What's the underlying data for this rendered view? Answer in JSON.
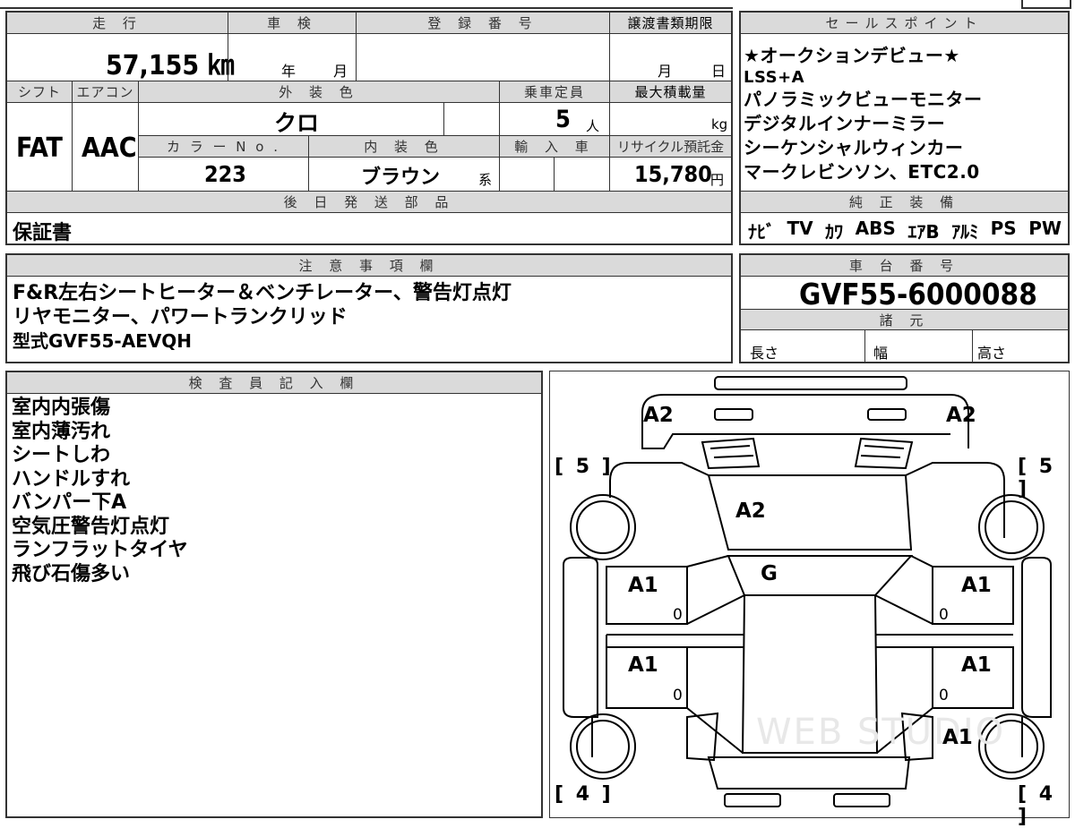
{
  "info": {
    "mileage_header": "走 行",
    "mileage": "57,155 ㎞",
    "inspection_header": "車 検",
    "inspection_year": "年",
    "inspection_month": "月",
    "registration_header": "登 録 番 号",
    "transfer_header": "譲渡書類期限",
    "transfer_month": "月",
    "transfer_day": "日",
    "shift_header": "シフト",
    "shift": "FAT",
    "ac_header": "エアコン",
    "ac": "AAC",
    "exterior_header": "外 装 色",
    "exterior_color": "クロ",
    "capacity_header": "乗車定員",
    "capacity": "5",
    "capacity_unit": "人",
    "max_load_header": "最大積載量",
    "max_load_unit": "kg",
    "color_no_header": "カ ラ ー N o .",
    "color_no": "223",
    "interior_header": "内 装 色",
    "interior_color": "ブラウン",
    "interior_suffix": "系",
    "import_header": "輸 入 車",
    "recycle_header": "リサイクル預託金",
    "recycle_fee": "15,780",
    "recycle_unit": "円",
    "later_parts_header": "後 日 発 送 部 品",
    "later_parts": "保証書"
  },
  "sales": {
    "header": "セールスポイント",
    "lines": [
      "★オークションデビュー★",
      "LSS+A",
      "パノラミックビューモニター",
      "デジタルインナーミラー",
      "シーケンシャルウィンカー",
      "マークレビンソン、ETC2.0"
    ]
  },
  "equipment": {
    "header": "純 正 装 備",
    "items": [
      "ﾅﾋﾞ",
      "TV",
      "ｶﾜ",
      "ABS",
      "ｴｱB",
      "ｱﾙﾐ",
      "PS",
      "PW"
    ]
  },
  "notes": {
    "header": "注 意 事 項 欄",
    "lines": [
      "F&R左右シートヒーター＆ベンチレーター、警告灯点灯",
      "リヤモニター、パワートランクリッド",
      "型式GVF55-AEVQH"
    ]
  },
  "chassis": {
    "header": "車 台 番 号",
    "number": "GVF55-6000088"
  },
  "specs": {
    "header": "諸 元",
    "length": "長さ",
    "width": "幅",
    "height": "高さ"
  },
  "inspector": {
    "header": "検 査 員 記 入 欄",
    "lines": [
      "室内内張傷",
      "室内薄汚れ",
      "シートしわ",
      "ハンドルすれ",
      "バンパー下A",
      "空気圧警告灯点灯",
      "ランフラットタイヤ",
      "飛び石傷多い"
    ]
  },
  "diagram": {
    "bracket_front_left": "[ 5 ]",
    "bracket_front_right": "[ 5 ]",
    "bracket_rear_left": "[ 4 ]",
    "bracket_rear_right": "[ 4 ]",
    "label_a2_left": "A2",
    "label_a2_right": "A2",
    "label_a2_hood": "A2",
    "label_g_windshield": "G",
    "label_a1_fl": "A1",
    "label_a1_fr": "A1",
    "label_a1_rl": "A1",
    "label_a1_rr": "A1",
    "label_a1_rear_right": "A1",
    "zero_fl": "0",
    "zero_fr": "0",
    "zero_rl": "0",
    "zero_rr": "0",
    "watermark": "WEB STUDIO"
  }
}
